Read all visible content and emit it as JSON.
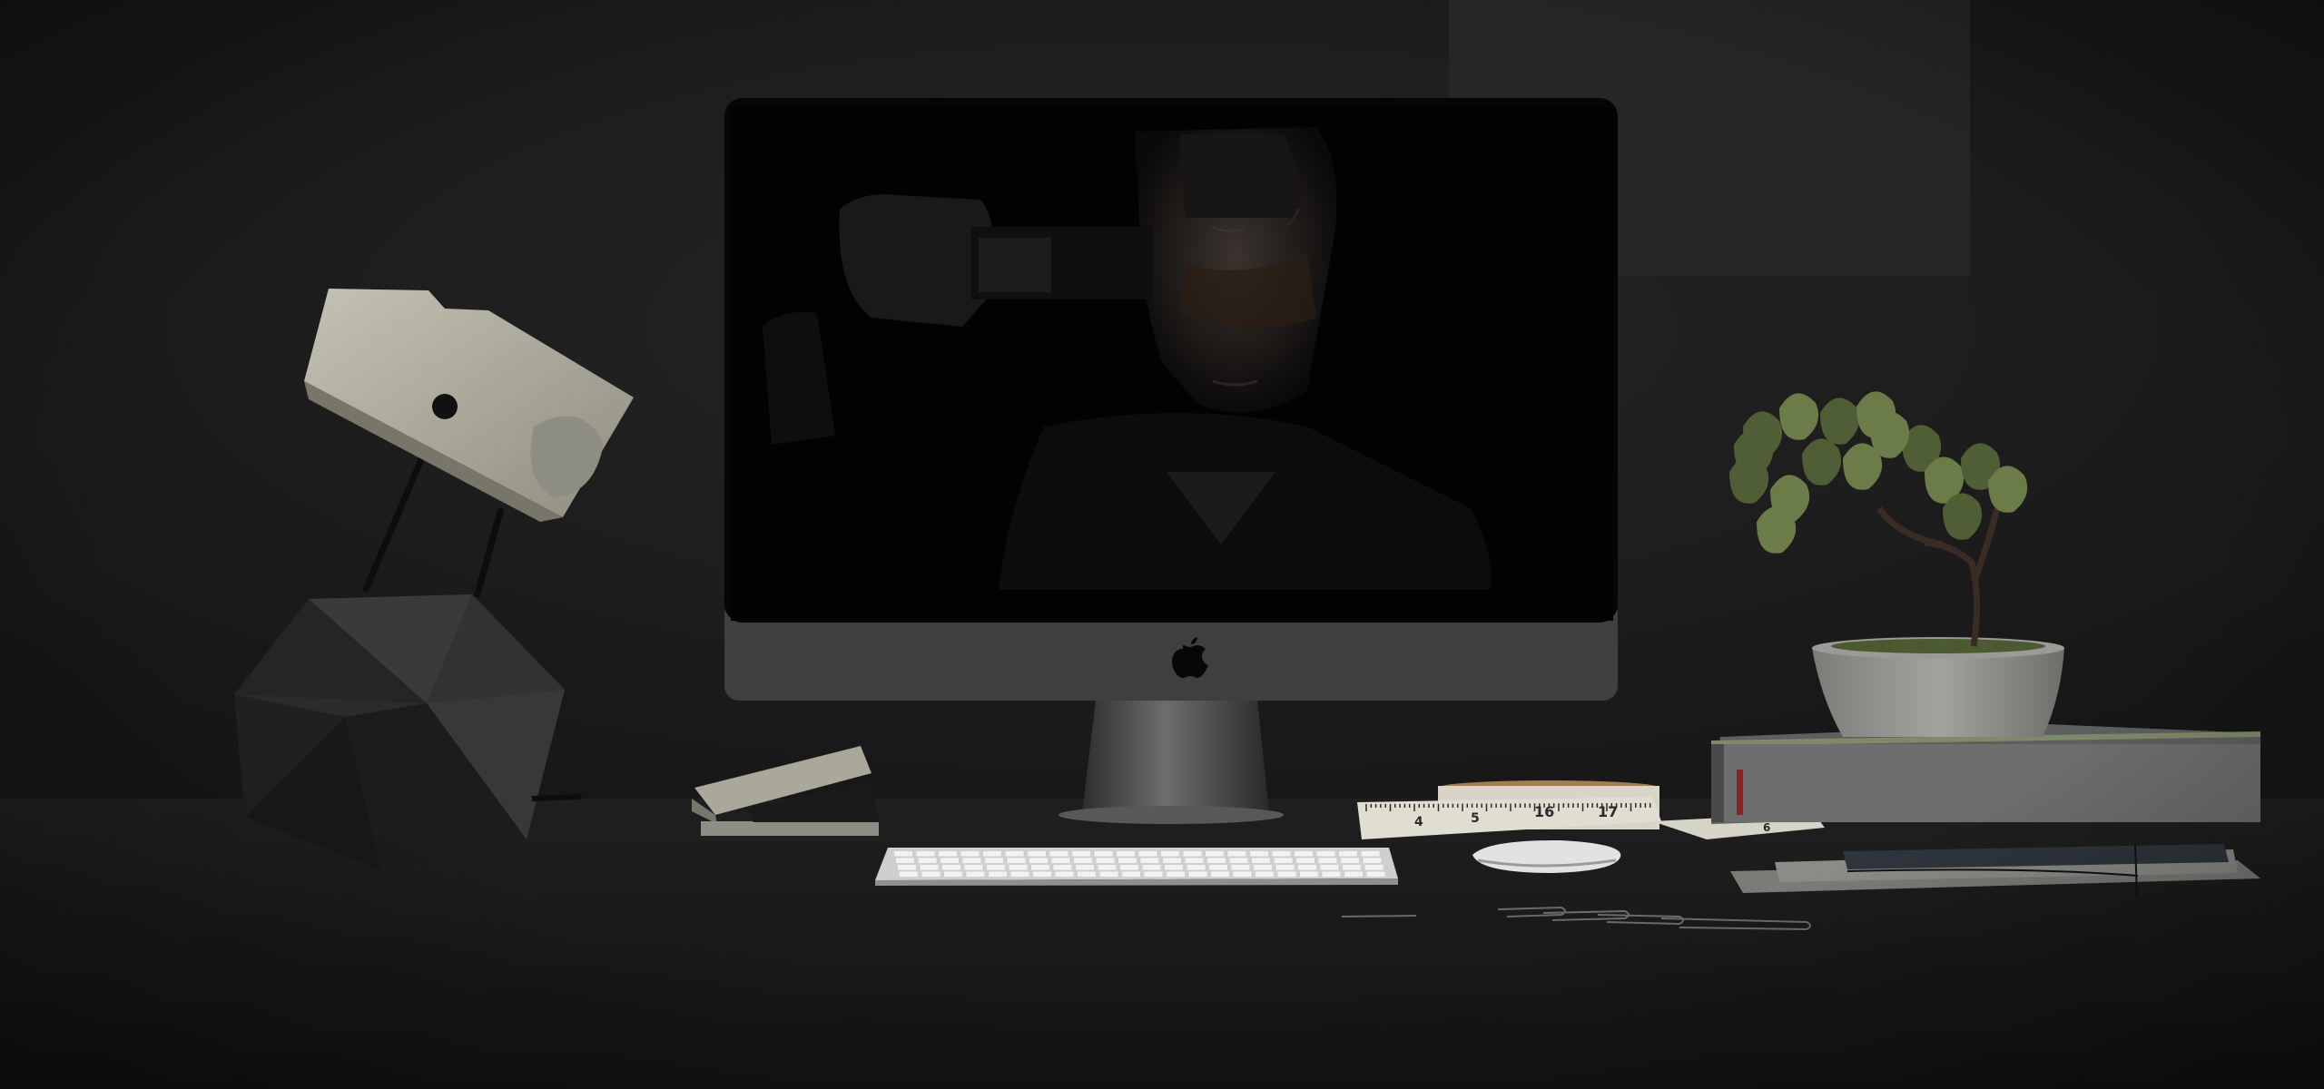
{
  "scene": {
    "colors": {
      "wall": "#1e1e1e",
      "desk": "#1b1b1b",
      "poster": "#262626",
      "monitor_body": "#3e3e3e",
      "screen": "#020202",
      "lamp_wood": "#b4b3a5",
      "lamp_base": "#2c2c2c",
      "plant_leaf": "#5b6b3e",
      "pot": "#8c8c88",
      "book_green": "#7f8a6b",
      "keyboard": "#c9c9c9",
      "mouse": "#d8d8d8"
    },
    "icons": [
      "apple-logo-icon"
    ]
  },
  "tape_measure": {
    "marks": [
      "4",
      "5",
      "16",
      "17",
      "6"
    ]
  }
}
